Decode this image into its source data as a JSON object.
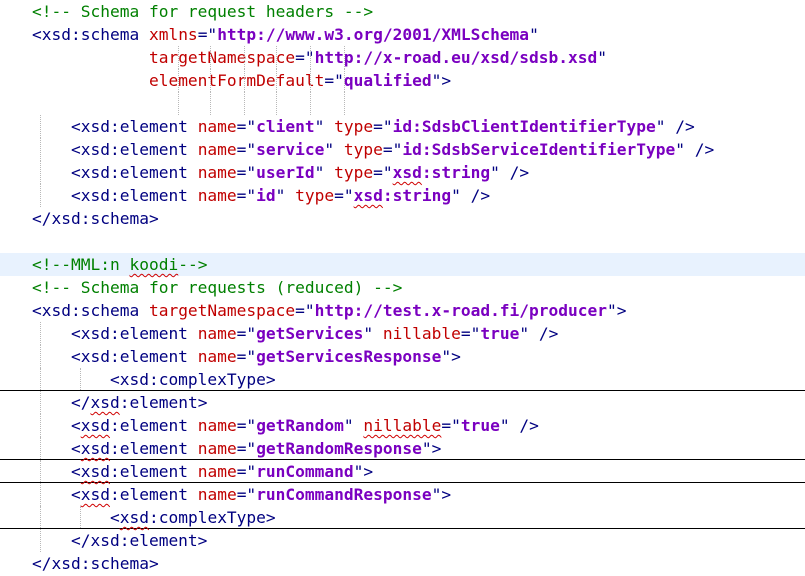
{
  "editor": {
    "colors": {
      "background": "#ffffff",
      "comment": "#008000",
      "tag": "#000080",
      "attribute": "#c00000",
      "value": "#7a00c0",
      "current_line": "#e8f2fe",
      "spellcheck": "#d00000"
    },
    "lines": [
      {
        "tokens": [
          {
            "t": "<!-- Schema for request headers -->",
            "k": "comment"
          }
        ]
      },
      {
        "tokens": [
          {
            "t": "<xsd:schema ",
            "k": "tag"
          },
          {
            "t": "xmlns",
            "k": "attr"
          },
          {
            "t": "=\"",
            "k": "tag"
          },
          {
            "t": "http://www.w3.org/2001/XMLSchema",
            "k": "val"
          },
          {
            "t": "\"",
            "k": "tag"
          }
        ]
      },
      {
        "tokens": [
          {
            "t": "            ",
            "k": "text"
          },
          {
            "t": "targetNamespace",
            "k": "attr"
          },
          {
            "t": "=\"",
            "k": "tag"
          },
          {
            "t": "http://x-road.eu/xsd/sdsb.xsd",
            "k": "val"
          },
          {
            "t": "\"",
            "k": "tag"
          }
        ]
      },
      {
        "tokens": [
          {
            "t": "            ",
            "k": "text"
          },
          {
            "t": "elementFormDefault",
            "k": "attr"
          },
          {
            "t": "=\"",
            "k": "tag"
          },
          {
            "t": "qualified",
            "k": "val"
          },
          {
            "t": "\">",
            "k": "tag"
          }
        ]
      },
      {
        "tokens": []
      },
      {
        "tokens": [
          {
            "t": "    <xsd:element ",
            "k": "tag"
          },
          {
            "t": "name",
            "k": "attr"
          },
          {
            "t": "=\"",
            "k": "tag"
          },
          {
            "t": "client",
            "k": "val"
          },
          {
            "t": "\" ",
            "k": "tag"
          },
          {
            "t": "type",
            "k": "attr"
          },
          {
            "t": "=\"",
            "k": "tag"
          },
          {
            "t": "id:SdsbClientIdentifierType",
            "k": "val"
          },
          {
            "t": "\" />",
            "k": "tag"
          }
        ]
      },
      {
        "tokens": [
          {
            "t": "    <xsd:element ",
            "k": "tag"
          },
          {
            "t": "name",
            "k": "attr"
          },
          {
            "t": "=\"",
            "k": "tag"
          },
          {
            "t": "service",
            "k": "val"
          },
          {
            "t": "\" ",
            "k": "tag"
          },
          {
            "t": "type",
            "k": "attr"
          },
          {
            "t": "=\"",
            "k": "tag"
          },
          {
            "t": "id:SdsbServiceIdentifierType",
            "k": "val"
          },
          {
            "t": "\" />",
            "k": "tag"
          }
        ]
      },
      {
        "tokens": [
          {
            "t": "    <xsd:element ",
            "k": "tag"
          },
          {
            "t": "name",
            "k": "attr"
          },
          {
            "t": "=\"",
            "k": "tag"
          },
          {
            "t": "userId",
            "k": "val"
          },
          {
            "t": "\" ",
            "k": "tag"
          },
          {
            "t": "type",
            "k": "attr"
          },
          {
            "t": "=\"",
            "k": "tag"
          },
          {
            "t": "xsd",
            "k": "val",
            "sq": true
          },
          {
            "t": ":string",
            "k": "val"
          },
          {
            "t": "\" />",
            "k": "tag"
          }
        ]
      },
      {
        "tokens": [
          {
            "t": "    <xsd:element ",
            "k": "tag"
          },
          {
            "t": "name",
            "k": "attr"
          },
          {
            "t": "=\"",
            "k": "tag"
          },
          {
            "t": "id",
            "k": "val"
          },
          {
            "t": "\" ",
            "k": "tag"
          },
          {
            "t": "type",
            "k": "attr"
          },
          {
            "t": "=\"",
            "k": "tag"
          },
          {
            "t": "xsd",
            "k": "val",
            "sq": true
          },
          {
            "t": ":string",
            "k": "val"
          },
          {
            "t": "\" />",
            "k": "tag"
          }
        ]
      },
      {
        "tokens": [
          {
            "t": "</xsd:schema>",
            "k": "tag"
          }
        ]
      },
      {
        "tokens": []
      },
      {
        "current": true,
        "tokens": [
          {
            "t": "<!--MML:n ",
            "k": "comment"
          },
          {
            "t": "koodi",
            "k": "comment",
            "sq": true
          },
          {
            "t": "-->",
            "k": "comment"
          }
        ]
      },
      {
        "tokens": [
          {
            "t": "<!-- Schema for requests (reduced) -->",
            "k": "comment"
          }
        ]
      },
      {
        "tokens": [
          {
            "t": "<xsd:schema ",
            "k": "tag"
          },
          {
            "t": "targetNamespace",
            "k": "attr"
          },
          {
            "t": "=\"",
            "k": "tag"
          },
          {
            "t": "http://test.x-road.fi/producer",
            "k": "val"
          },
          {
            "t": "\">",
            "k": "tag"
          }
        ]
      },
      {
        "tokens": [
          {
            "t": "    <xsd:element ",
            "k": "tag"
          },
          {
            "t": "name",
            "k": "attr"
          },
          {
            "t": "=\"",
            "k": "tag"
          },
          {
            "t": "getServices",
            "k": "val"
          },
          {
            "t": "\" ",
            "k": "tag"
          },
          {
            "t": "nillable",
            "k": "attr"
          },
          {
            "t": "=\"",
            "k": "tag"
          },
          {
            "t": "true",
            "k": "val"
          },
          {
            "t": "\" />",
            "k": "tag"
          }
        ]
      },
      {
        "tokens": [
          {
            "t": "    <xsd:element ",
            "k": "tag"
          },
          {
            "t": "name",
            "k": "attr"
          },
          {
            "t": "=\"",
            "k": "tag"
          },
          {
            "t": "getServicesResponse",
            "k": "val"
          },
          {
            "t": "\">",
            "k": "tag"
          }
        ]
      },
      {
        "sep": true,
        "tokens": [
          {
            "t": "        <xsd:complexType>",
            "k": "tag"
          }
        ]
      },
      {
        "tokens": [
          {
            "t": "    </",
            "k": "tag"
          },
          {
            "t": "xsd",
            "k": "tag",
            "sq": true
          },
          {
            "t": ":element>",
            "k": "tag"
          }
        ]
      },
      {
        "tokens": [
          {
            "t": "    <",
            "k": "tag"
          },
          {
            "t": "xsd",
            "k": "tag",
            "sq": true
          },
          {
            "t": ":element ",
            "k": "tag"
          },
          {
            "t": "name",
            "k": "attr"
          },
          {
            "t": "=\"",
            "k": "tag"
          },
          {
            "t": "getRandom",
            "k": "val"
          },
          {
            "t": "\" ",
            "k": "tag"
          },
          {
            "t": "nillable",
            "k": "attr",
            "sq": true
          },
          {
            "t": "=\"",
            "k": "tag"
          },
          {
            "t": "true",
            "k": "val"
          },
          {
            "t": "\" />",
            "k": "tag"
          }
        ]
      },
      {
        "sep": true,
        "tokens": [
          {
            "t": "    <",
            "k": "tag"
          },
          {
            "t": "xsd",
            "k": "tag",
            "sq": true
          },
          {
            "t": ":element ",
            "k": "tag"
          },
          {
            "t": "name",
            "k": "attr"
          },
          {
            "t": "=\"",
            "k": "tag"
          },
          {
            "t": "getRandomResponse",
            "k": "val"
          },
          {
            "t": "\">",
            "k": "tag"
          }
        ]
      },
      {
        "sep": true,
        "tokens": [
          {
            "t": "    <",
            "k": "tag"
          },
          {
            "t": "xsd",
            "k": "tag",
            "sq": true
          },
          {
            "t": ":element ",
            "k": "tag"
          },
          {
            "t": "name",
            "k": "attr"
          },
          {
            "t": "=\"",
            "k": "tag"
          },
          {
            "t": "runCommand",
            "k": "val"
          },
          {
            "t": "\">",
            "k": "tag"
          }
        ]
      },
      {
        "tokens": [
          {
            "t": "    <",
            "k": "tag"
          },
          {
            "t": "xsd",
            "k": "tag",
            "sq": true
          },
          {
            "t": ":element ",
            "k": "tag"
          },
          {
            "t": "name",
            "k": "attr"
          },
          {
            "t": "=\"",
            "k": "tag"
          },
          {
            "t": "runCommandResponse",
            "k": "val"
          },
          {
            "t": "\">",
            "k": "tag"
          }
        ]
      },
      {
        "sep": true,
        "tokens": [
          {
            "t": "        <",
            "k": "tag"
          },
          {
            "t": "xsd",
            "k": "tag",
            "sq": true
          },
          {
            "t": ":complexType>",
            "k": "tag"
          }
        ]
      },
      {
        "tokens": [
          {
            "t": "    </xsd:element>",
            "k": "tag"
          }
        ]
      },
      {
        "tokens": [
          {
            "t": "</xsd:schema>",
            "k": "tag"
          }
        ]
      }
    ]
  }
}
